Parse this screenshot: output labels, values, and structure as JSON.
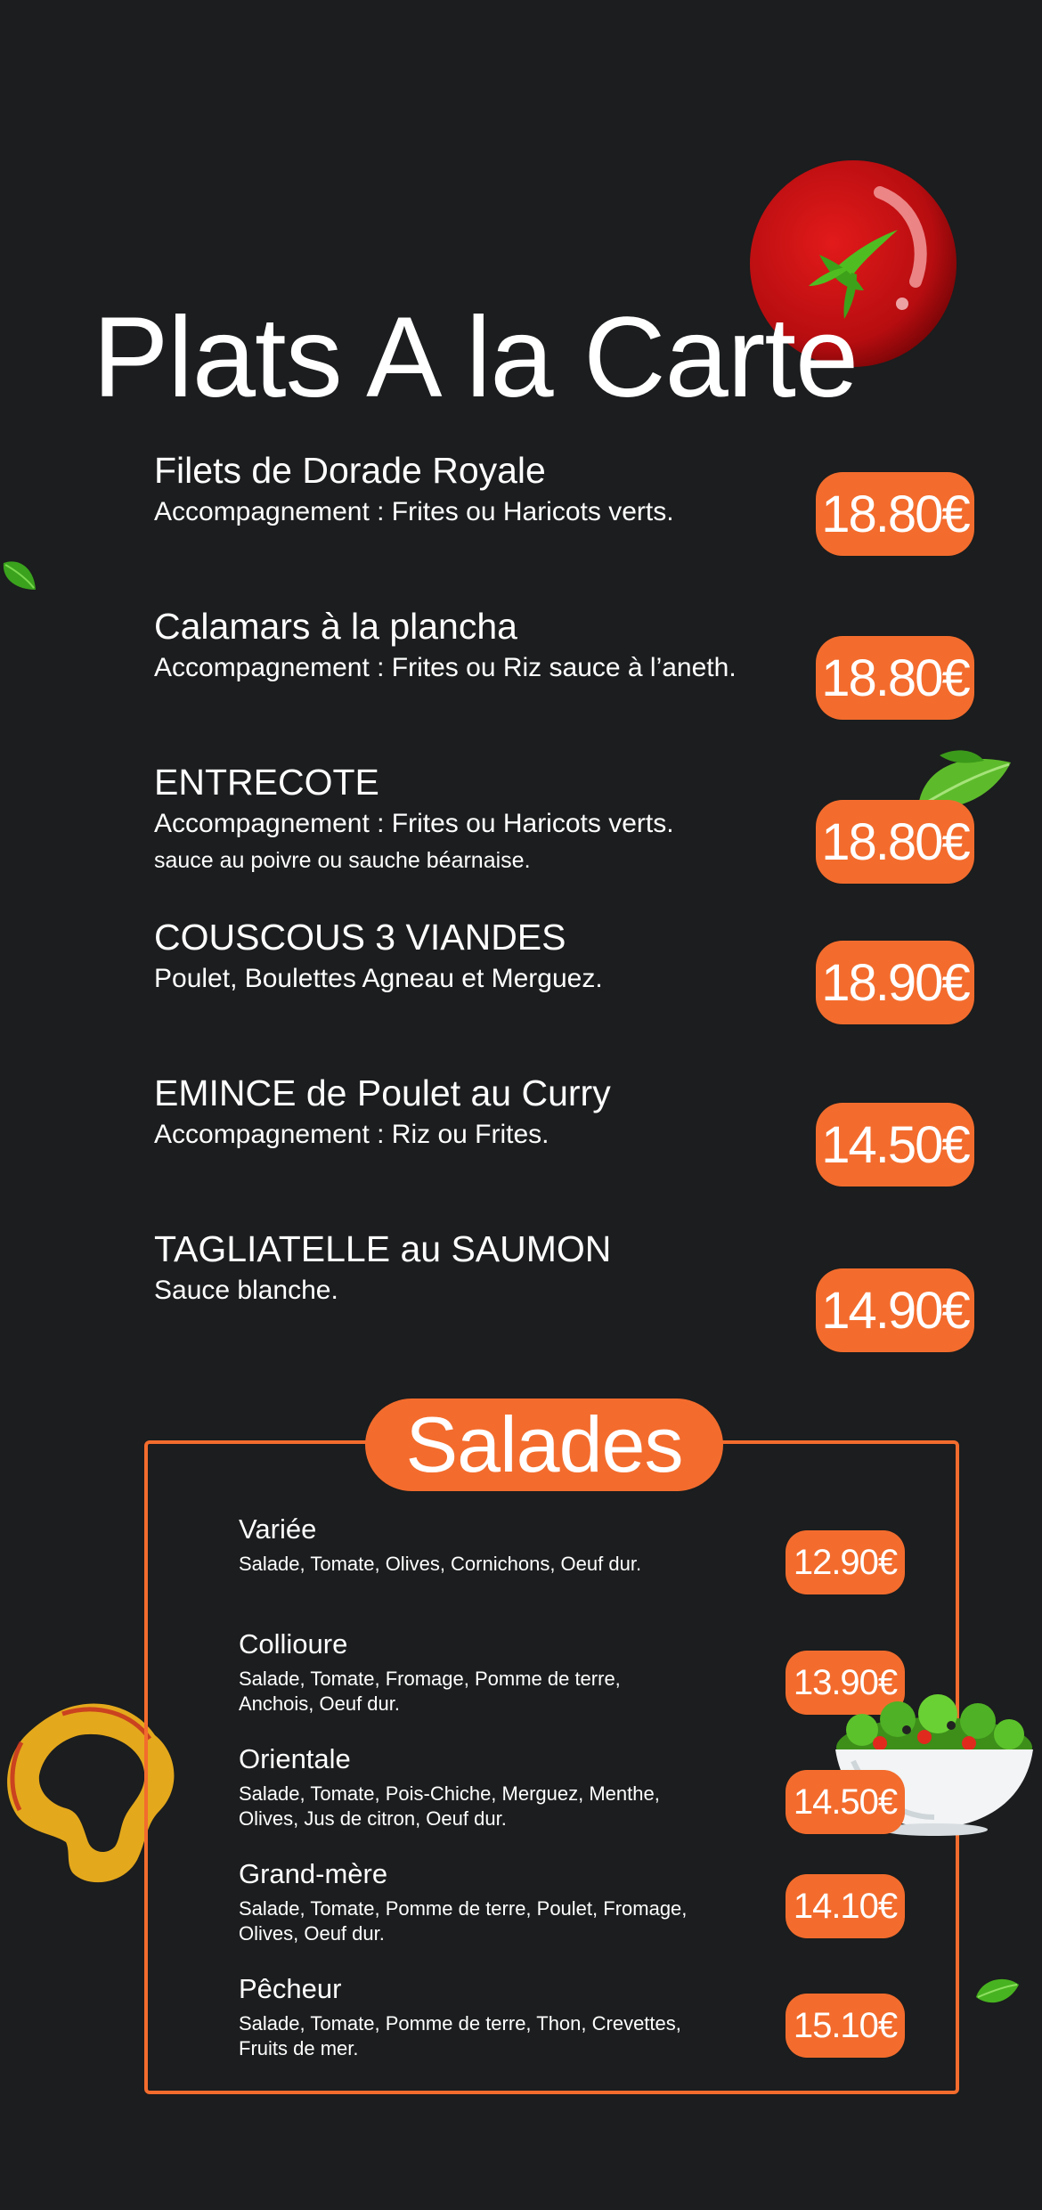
{
  "title": "Plats A la Carte",
  "plats": [
    {
      "name": "Filets de Dorade Royale",
      "desc": "Accompagnement : Frites ou Haricots verts.",
      "note": "",
      "price": "18.80€"
    },
    {
      "name": "Calamars à la plancha",
      "desc": "Accompagnement : Frites ou Riz sauce à l’aneth.",
      "note": "",
      "price": "18.80€"
    },
    {
      "name": "ENTRECOTE",
      "desc": "Accompagnement : Frites ou Haricots verts.",
      "note": "sauce au poivre ou sauche béarnaise.",
      "price": "18.80€"
    },
    {
      "name": "COUSCOUS 3 VIANDES",
      "desc": "Poulet, Boulettes Agneau et Merguez.",
      "note": "",
      "price": "18.90€"
    },
    {
      "name": "EMINCE de Poulet au Curry",
      "desc": "Accompagnement : Riz ou Frites.",
      "note": "",
      "price": "14.50€"
    },
    {
      "name": "TAGLIATELLE au SAUMON",
      "desc": "Sauce blanche.",
      "note": "",
      "price": "14.90€"
    }
  ],
  "salades": {
    "header": "Salades",
    "items": [
      {
        "name": "Variée",
        "desc": "Salade, Tomate, Olives, Cornichons, Oeuf dur.",
        "price": "12.90€"
      },
      {
        "name": "Collioure",
        "desc": "Salade, Tomate,  Fromage, Pomme de terre, Anchois, Oeuf dur.",
        "price": "13.90€"
      },
      {
        "name": "Orientale",
        "desc": "Salade, Tomate, Pois-Chiche, Merguez, Menthe, Olives, Jus de citron, Oeuf dur.",
        "price": "14.50€"
      },
      {
        "name": "Grand-mère",
        "desc": "Salade, Tomate, Pomme de terre, Poulet, Fromage, Olives, Oeuf dur.",
        "price": "14.10€"
      },
      {
        "name": "Pêcheur",
        "desc": "Salade, Tomate, Pomme de terre, Thon, Crevettes, Fruits de mer.",
        "price": "15.10€"
      }
    ]
  },
  "colors": {
    "background": "#1b1d1e",
    "accent": "#f36c2d",
    "text": "#ffffff"
  },
  "decorations": [
    "tomato-icon",
    "leaf-icon",
    "basil-leaf-icon",
    "pepper-ring-icon",
    "salad-bowl-icon"
  ]
}
